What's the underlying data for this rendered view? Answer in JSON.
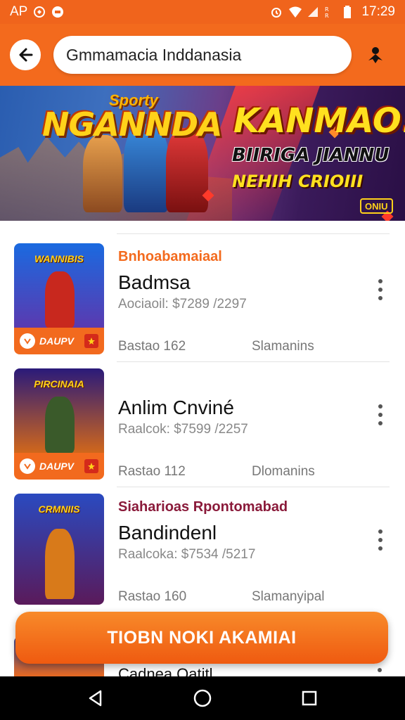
{
  "status_bar": {
    "left_text": "AP",
    "time": "17:29"
  },
  "header": {
    "search_value": "Gmmamacia Inddanasia"
  },
  "banner": {
    "subtitle": "Sporty",
    "title_left": "NGANNDA",
    "title_right": "KANMAO!",
    "line1": "BIIRIGA JIANNU",
    "line2": "NEHIH CRIOIII",
    "badge": "ONIU"
  },
  "items": [
    {
      "category": "Bnhoabamaiaal",
      "title": "Badmsa",
      "meta": "Aociaoil: $7289 /2297",
      "left_stat": "Bastao 162",
      "right_stat": "Slamanins",
      "thumb_title": "WANNIBIS",
      "thumb_label": "DAUPV",
      "colors": {
        "top": "#1a6ae0",
        "bottom": "#5a3ab0",
        "figure": "#c8281e"
      }
    },
    {
      "category": "",
      "title": "Anlim Cnviné",
      "meta": "Raalcok: $7599 /2257",
      "left_stat": "Rastao 112",
      "right_stat": "Dlomanins",
      "thumb_title": "PIRCINAIA",
      "thumb_label": "DAUPV",
      "colors": {
        "top": "#2a1a7a",
        "bottom": "#d0671c",
        "figure": "#3a5a2a"
      }
    },
    {
      "category": "Siaharioas Rpontomabad",
      "title": "Bandindenl",
      "meta": "Raalcoka: $7534 /5217",
      "left_stat": "Rastao 160",
      "right_stat": "Slamanyipal",
      "thumb_title": "CRMNIIS",
      "thumb_label": "",
      "colors": {
        "top": "#2a4ac0",
        "bottom": "#5a1a5a",
        "figure": "#d87a1a"
      }
    }
  ],
  "cta": {
    "label": "TIOBN NOKI AKAMIAI"
  },
  "peek": {
    "text": "Cadnea Qatitl"
  }
}
